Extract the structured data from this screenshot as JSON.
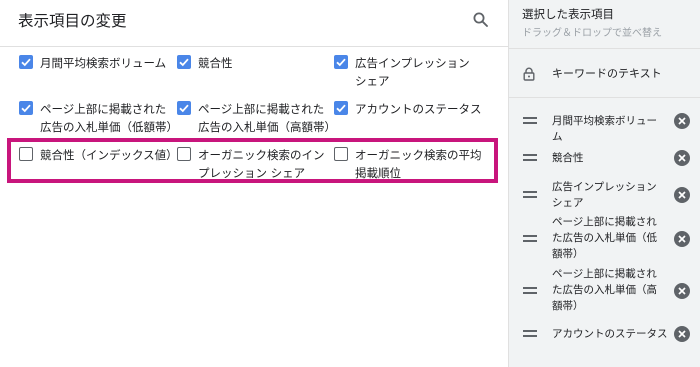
{
  "header": {
    "title": "表示項目の変更",
    "search_icon": "search-icon"
  },
  "options": [
    {
      "label": "月間平均検索ボリューム",
      "checked": true
    },
    {
      "label": "競合性",
      "checked": true
    },
    {
      "label": "広告インプレッション シェア",
      "checked": true
    },
    {
      "label": "ページ上部に掲載された広告の入札単価（低額帯）",
      "checked": true
    },
    {
      "label": "ページ上部に掲載された広告の入札単価（高額帯）",
      "checked": true
    },
    {
      "label": "アカウントのステータス",
      "checked": true
    },
    {
      "label": "競合性（インデックス値）",
      "checked": false
    },
    {
      "label": "オーガニック検索のインプレッション シェア",
      "checked": false
    },
    {
      "label": "オーガニック検索の平均掲載順位",
      "checked": false
    }
  ],
  "selected_panel": {
    "title": "選択した表示項目",
    "subtitle": "ドラッグ＆ドロップで並べ替え",
    "fixed_item": {
      "label": "キーワードのテキスト",
      "icon": "lock-icon"
    },
    "items": [
      {
        "label": "月間平均検索ボリューム"
      },
      {
        "label": "競合性"
      },
      {
        "label": "広告インプレッション シェア"
      },
      {
        "label": "ページ上部に掲載された広告の入札単価（低額帯）"
      },
      {
        "label": "ページ上部に掲載された広告の入札単価（高額帯）"
      },
      {
        "label": "アカウントのステータス"
      }
    ]
  },
  "colors": {
    "checkbox_checked": "#4a86e8",
    "highlight_border": "#c8157c",
    "panel_bg": "#f1f3f4"
  }
}
